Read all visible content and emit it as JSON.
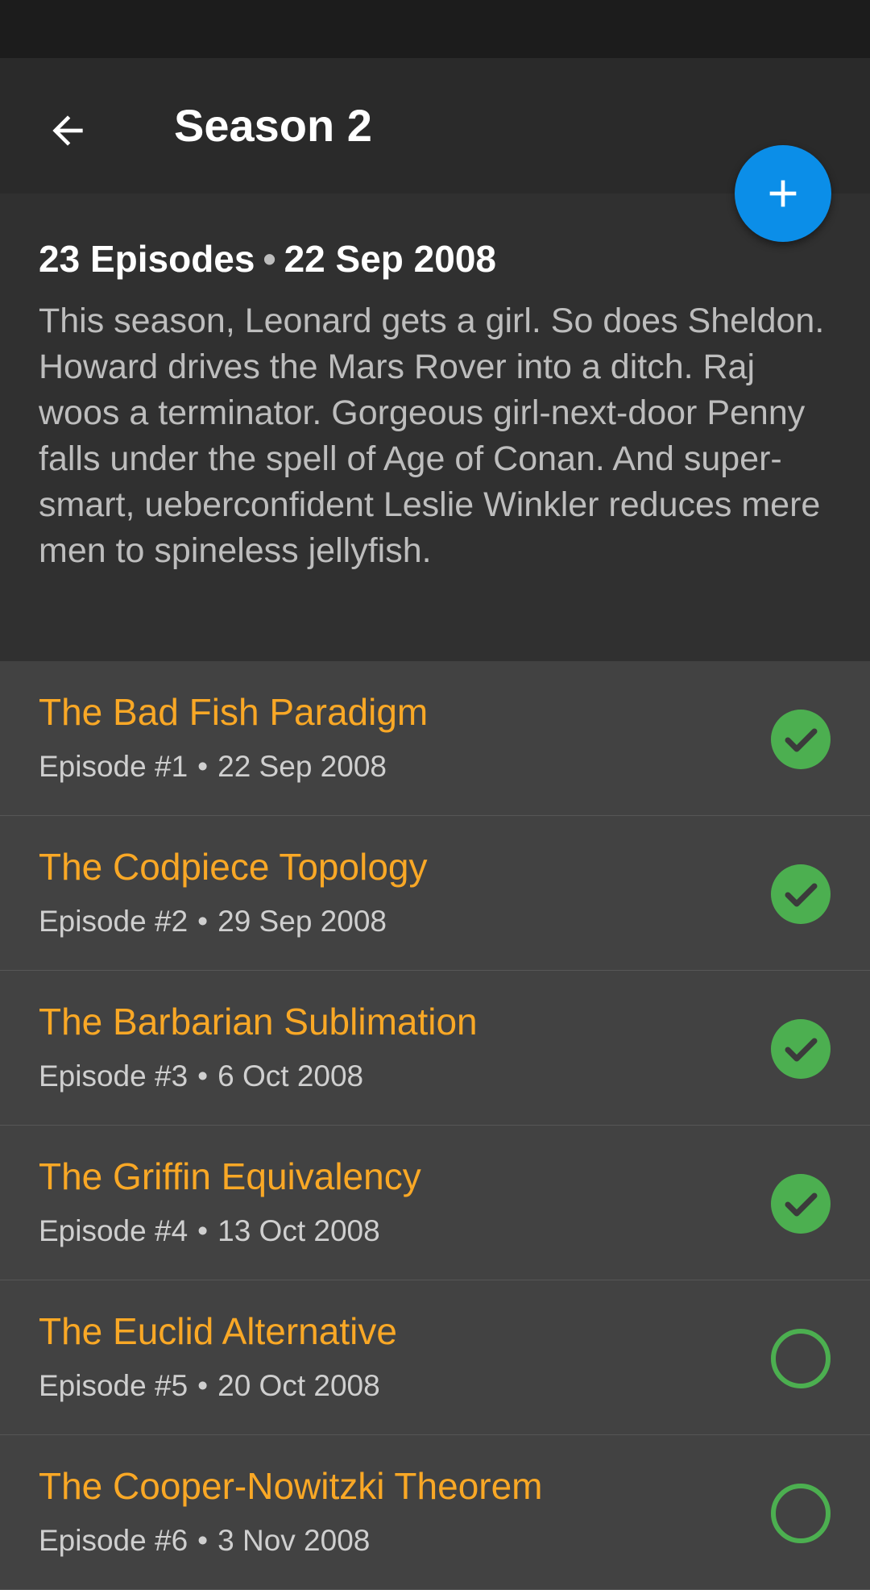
{
  "app_bar": {
    "title": "Season 2"
  },
  "season": {
    "episode_count": "23 Episodes",
    "separator": "•",
    "air_date": "22 Sep 2008",
    "description": "This season, Leonard gets a girl. So does Sheldon. Howard drives the Mars Rover into a ditch. Raj woos a terminator. Gorgeous girl-next-door Penny falls under the spell of Age of Conan. And super-smart, ueberconfident Leslie Winkler reduces mere men to spineless jellyfish."
  },
  "episodes": [
    {
      "title": "The Bad Fish Paradigm",
      "number": "Episode #1",
      "date": "22 Sep 2008",
      "watched": true
    },
    {
      "title": "The Codpiece Topology",
      "number": "Episode #2",
      "date": "29 Sep 2008",
      "watched": true
    },
    {
      "title": "The Barbarian Sublimation",
      "number": "Episode #3",
      "date": "6 Oct 2008",
      "watched": true
    },
    {
      "title": "The Griffin Equivalency",
      "number": "Episode #4",
      "date": "13 Oct 2008",
      "watched": true
    },
    {
      "title": "The Euclid Alternative",
      "number": "Episode #5",
      "date": "20 Oct 2008",
      "watched": false
    },
    {
      "title": "The Cooper-Nowitzki Theorem",
      "number": "Episode #6",
      "date": "3 Nov 2008",
      "watched": false
    }
  ],
  "icons": {
    "back": "arrow-back-icon",
    "add": "plus-icon",
    "watched": "check-circle-icon",
    "unwatched": "empty-circle-icon"
  },
  "colors": {
    "accent_orange": "#f9a826",
    "fab_blue": "#0b8ee8",
    "watched_green": "#4caf50"
  }
}
